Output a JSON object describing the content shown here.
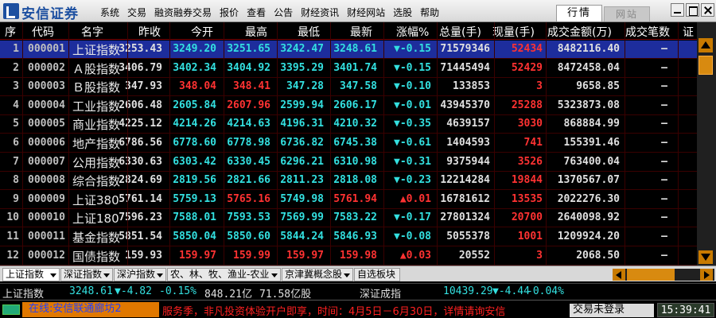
{
  "app": {
    "name": "安信证券"
  },
  "menu": [
    "系统",
    "交易",
    "融资融券交易",
    "报价",
    "查看",
    "公告",
    "财经资讯",
    "财经网站",
    "选股",
    "帮助"
  ],
  "top_tabs": {
    "active": "行情",
    "inactive": "网站"
  },
  "columns": [
    "序",
    "代码",
    "名字",
    "昨收",
    "今开",
    "最高",
    "最低",
    "最新",
    "涨幅%",
    "总量(手)",
    "现量(手)",
    "成交金额(万)",
    "成交笔数",
    "证"
  ],
  "rows": [
    {
      "seq": "1",
      "code": "000001",
      "name": "上证指数",
      "prev": "3253.43",
      "open": "3249.20",
      "high": "3251.65",
      "low": "3242.47",
      "last": "3248.61",
      "chg": "▼-0.15",
      "vol": "71579346",
      "cur": "52434",
      "amt": "8482116.40",
      "cnt": "—",
      "o": "cyan",
      "h": "cyan",
      "l": "cyan",
      "la": "cyan",
      "c": "cyan"
    },
    {
      "seq": "2",
      "code": "000002",
      "name": "Ａ股指数",
      "prev": "3406.79",
      "open": "3402.34",
      "high": "3404.92",
      "low": "3395.29",
      "last": "3401.74",
      "chg": "▼-0.15",
      "vol": "71445494",
      "cur": "52429",
      "amt": "8472458.04",
      "cnt": "—",
      "o": "cyan",
      "h": "cyan",
      "l": "cyan",
      "la": "cyan",
      "c": "cyan"
    },
    {
      "seq": "3",
      "code": "000003",
      "name": "Ｂ股指数",
      "prev": "347.93",
      "open": "348.04",
      "high": "348.41",
      "low": "347.28",
      "last": "347.58",
      "chg": "▼-0.10",
      "vol": "133853",
      "cur": "3",
      "amt": "9658.85",
      "cnt": "—",
      "o": "red",
      "h": "red",
      "l": "cyan",
      "la": "cyan",
      "c": "cyan"
    },
    {
      "seq": "4",
      "code": "000004",
      "name": "工业指数",
      "prev": "2606.48",
      "open": "2605.84",
      "high": "2607.96",
      "low": "2599.94",
      "last": "2606.17",
      "chg": "▼-0.01",
      "vol": "43945370",
      "cur": "25288",
      "amt": "5323873.08",
      "cnt": "—",
      "o": "cyan",
      "h": "red",
      "l": "cyan",
      "la": "cyan",
      "c": "cyan"
    },
    {
      "seq": "5",
      "code": "000005",
      "name": "商业指数",
      "prev": "4225.12",
      "open": "4214.26",
      "high": "4214.63",
      "low": "4196.31",
      "last": "4210.32",
      "chg": "▼-0.35",
      "vol": "4639157",
      "cur": "3030",
      "amt": "868884.99",
      "cnt": "—",
      "o": "cyan",
      "h": "cyan",
      "l": "cyan",
      "la": "cyan",
      "c": "cyan"
    },
    {
      "seq": "6",
      "code": "000006",
      "name": "地产指数",
      "prev": "6786.56",
      "open": "6778.60",
      "high": "6778.98",
      "low": "6736.82",
      "last": "6745.38",
      "chg": "▼-0.61",
      "vol": "1404593",
      "cur": "741",
      "amt": "155391.46",
      "cnt": "—",
      "o": "cyan",
      "h": "cyan",
      "l": "cyan",
      "la": "cyan",
      "c": "cyan"
    },
    {
      "seq": "7",
      "code": "000007",
      "name": "公用指数",
      "prev": "6330.63",
      "open": "6303.42",
      "high": "6330.45",
      "low": "6296.21",
      "last": "6310.98",
      "chg": "▼-0.31",
      "vol": "9375944",
      "cur": "3526",
      "amt": "763400.04",
      "cnt": "—",
      "o": "cyan",
      "h": "cyan",
      "l": "cyan",
      "la": "cyan",
      "c": "cyan"
    },
    {
      "seq": "8",
      "code": "000008",
      "name": "综合指数",
      "prev": "2824.69",
      "open": "2819.56",
      "high": "2821.66",
      "low": "2811.23",
      "last": "2818.08",
      "chg": "▼-0.23",
      "vol": "12214284",
      "cur": "19844",
      "amt": "1370567.07",
      "cnt": "—",
      "o": "cyan",
      "h": "cyan",
      "l": "cyan",
      "la": "cyan",
      "c": "cyan"
    },
    {
      "seq": "9",
      "code": "000009",
      "name": "上证380",
      "prev": "5761.14",
      "open": "5759.13",
      "high": "5765.16",
      "low": "5749.98",
      "last": "5761.94",
      "chg": "▲0.01",
      "vol": "16781612",
      "cur": "13535",
      "amt": "2022276.30",
      "cnt": "—",
      "o": "cyan",
      "h": "red",
      "l": "cyan",
      "la": "red",
      "c": "red"
    },
    {
      "seq": "10",
      "code": "000010",
      "name": "上证180",
      "prev": "7596.23",
      "open": "7588.01",
      "high": "7593.53",
      "low": "7569.99",
      "last": "7583.22",
      "chg": "▼-0.17",
      "vol": "27801324",
      "cur": "20700",
      "amt": "2640098.92",
      "cnt": "—",
      "o": "cyan",
      "h": "cyan",
      "l": "cyan",
      "la": "cyan",
      "c": "cyan"
    },
    {
      "seq": "11",
      "code": "000011",
      "name": "基金指数",
      "prev": "5851.54",
      "open": "5850.04",
      "high": "5850.60",
      "low": "5844.24",
      "last": "5846.93",
      "chg": "▼-0.08",
      "vol": "5055378",
      "cur": "1001",
      "amt": "1209924.20",
      "cnt": "—",
      "o": "cyan",
      "h": "cyan",
      "l": "cyan",
      "la": "cyan",
      "c": "cyan"
    },
    {
      "seq": "12",
      "code": "000012",
      "name": "国债指数",
      "prev": "159.93",
      "open": "159.97",
      "high": "159.99",
      "low": "159.97",
      "last": "159.98",
      "chg": "▲0.03",
      "vol": "20552",
      "cur": "3",
      "amt": "2068.50",
      "cnt": "—",
      "o": "red",
      "h": "red",
      "l": "red",
      "la": "red",
      "c": "red"
    }
  ],
  "category_tabs": [
    "上证指数",
    "深证指数",
    "深沪指数",
    "农、林、牧、渔业-农业",
    "京津冀概念股",
    "自选板块"
  ],
  "index_bar": {
    "sh_label": "上证指数",
    "sh_val": "3248.61",
    "sh_chg": "▼-4.82",
    "sh_pct": "-0.15%",
    "sh_amt": "848.21亿",
    "sh_vol": "71.58亿股",
    "sz_label": "深证成指",
    "sz_val": "10439.29",
    "sz_chg": "▼-4.44",
    "sz_pct": "-0.04%"
  },
  "status": {
    "online": "在线:安信联通廊坊2",
    "ticker": "服务季，非凡投资体验开户即享，时间：4月5日－6月30日，详情请询安信",
    "login": "交易未登录",
    "time": "15:39:41"
  },
  "colors": {
    "cyan": "#33e0e0",
    "red": "#ff3232",
    "select": "#1d2d9c",
    "accent": "#e07800"
  }
}
